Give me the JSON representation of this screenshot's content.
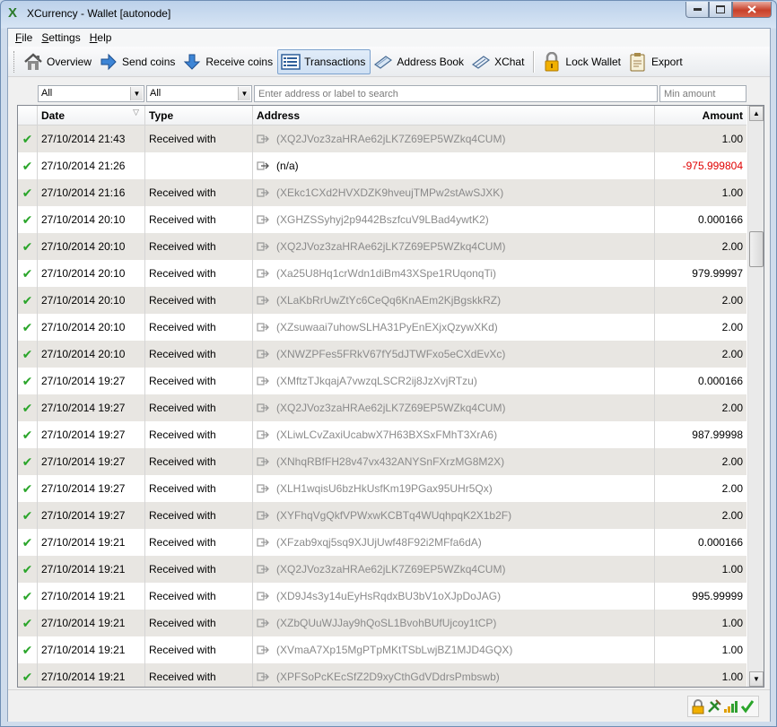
{
  "window": {
    "title": "XCurrency - Wallet [autonode]",
    "app_icon": "X"
  },
  "menu": [
    {
      "label": "File",
      "accel": "F",
      "rest": "ile"
    },
    {
      "label": "Settings",
      "accel": "S",
      "rest": "ettings"
    },
    {
      "label": "Help",
      "accel": "H",
      "rest": "elp"
    }
  ],
  "toolbar": {
    "overview": "Overview",
    "send": "Send coins",
    "receive": "Receive coins",
    "transactions": "Transactions",
    "address_book": "Address Book",
    "xchat": "XChat",
    "lock_wallet": "Lock Wallet",
    "export": "Export"
  },
  "filters": {
    "date_value": "All",
    "type_value": "All",
    "search_placeholder": "Enter address or label to search",
    "min_amount_placeholder": "Min amount"
  },
  "columns": {
    "date": "Date",
    "type": "Type",
    "address": "Address",
    "amount": "Amount"
  },
  "rows": [
    {
      "date": "27/10/2014 21:43",
      "type": "Received with",
      "address": "(XQ2JVoz3zaHRAe62jLK7Z69EP5WZkq4CUM)",
      "amount": "1.00"
    },
    {
      "date": "27/10/2014 21:26",
      "type": "",
      "address": "(n/a)",
      "amount": "-975.999804"
    },
    {
      "date": "27/10/2014 21:16",
      "type": "Received with",
      "address": "(XEkc1CXd2HVXDZK9hveujTMPw2stAwSJXK)",
      "amount": "1.00"
    },
    {
      "date": "27/10/2014 20:10",
      "type": "Received with",
      "address": "(XGHZSSyhyj2p9442BszfcuV9LBad4ywtK2)",
      "amount": "0.000166"
    },
    {
      "date": "27/10/2014 20:10",
      "type": "Received with",
      "address": "(XQ2JVoz3zaHRAe62jLK7Z69EP5WZkq4CUM)",
      "amount": "2.00"
    },
    {
      "date": "27/10/2014 20:10",
      "type": "Received with",
      "address": "(Xa25U8Hq1crWdn1diBm43XSpe1RUqonqTi)",
      "amount": "979.99997"
    },
    {
      "date": "27/10/2014 20:10",
      "type": "Received with",
      "address": "(XLaKbRrUwZtYc6CeQq6KnAEm2KjBgskkRZ)",
      "amount": "2.00"
    },
    {
      "date": "27/10/2014 20:10",
      "type": "Received with",
      "address": "(XZsuwaai7uhowSLHA31PyEnEXjxQzywXKd)",
      "amount": "2.00"
    },
    {
      "date": "27/10/2014 20:10",
      "type": "Received with",
      "address": "(XNWZPFes5FRkV67fY5dJTWFxo5eCXdEvXc)",
      "amount": "2.00"
    },
    {
      "date": "27/10/2014 19:27",
      "type": "Received with",
      "address": "(XMftzTJkqajA7vwzqLSCR2ij8JzXvjRTzu)",
      "amount": "0.000166"
    },
    {
      "date": "27/10/2014 19:27",
      "type": "Received with",
      "address": "(XQ2JVoz3zaHRAe62jLK7Z69EP5WZkq4CUM)",
      "amount": "2.00"
    },
    {
      "date": "27/10/2014 19:27",
      "type": "Received with",
      "address": "(XLiwLCvZaxiUcabwX7H63BXSxFMhT3XrA6)",
      "amount": "987.99998"
    },
    {
      "date": "27/10/2014 19:27",
      "type": "Received with",
      "address": "(XNhqRBfFH28v47vx432ANYSnFXrzMG8M2X)",
      "amount": "2.00"
    },
    {
      "date": "27/10/2014 19:27",
      "type": "Received with",
      "address": "(XLH1wqisU6bzHkUsfKm19PGax95UHr5Qx)",
      "amount": "2.00"
    },
    {
      "date": "27/10/2014 19:27",
      "type": "Received with",
      "address": "(XYFhqVgQkfVPWxwKCBTq4WUqhpqK2X1b2F)",
      "amount": "2.00"
    },
    {
      "date": "27/10/2014 19:21",
      "type": "Received with",
      "address": "(XFzab9xqj5sq9XJUjUwf48F92i2MFfa6dA)",
      "amount": "0.000166"
    },
    {
      "date": "27/10/2014 19:21",
      "type": "Received with",
      "address": "(XQ2JVoz3zaHRAe62jLK7Z69EP5WZkq4CUM)",
      "amount": "1.00"
    },
    {
      "date": "27/10/2014 19:21",
      "type": "Received with",
      "address": "(XD9J4s3y14uEyHsRqdxBU3bV1oXJpDoJAG)",
      "amount": "995.99999"
    },
    {
      "date": "27/10/2014 19:21",
      "type": "Received with",
      "address": "(XZbQUuWJJay9hQoSL1BvohBUfUjcoy1tCP)",
      "amount": "1.00"
    },
    {
      "date": "27/10/2014 19:21",
      "type": "Received with",
      "address": "(XVmaA7Xp15MgPTpMKtTSbLwjBZ1MJD4GQX)",
      "amount": "1.00"
    },
    {
      "date": "27/10/2014 19:21",
      "type": "Received with",
      "address": "(XPFSoPcKEcSfZ2D9xyCthGdVDdrsPmbswb)",
      "amount": "1.00"
    }
  ],
  "colors": {
    "confirmed_check": "#2aa52a",
    "negative_amount": "#e00000",
    "alt_row": "#e8e6e2"
  },
  "icons": {
    "status": "check-icon",
    "address": "arrow-right-icon",
    "status_bar": [
      "lock-icon",
      "mining-icon",
      "signal-bars-icon",
      "synced-check-icon"
    ]
  }
}
